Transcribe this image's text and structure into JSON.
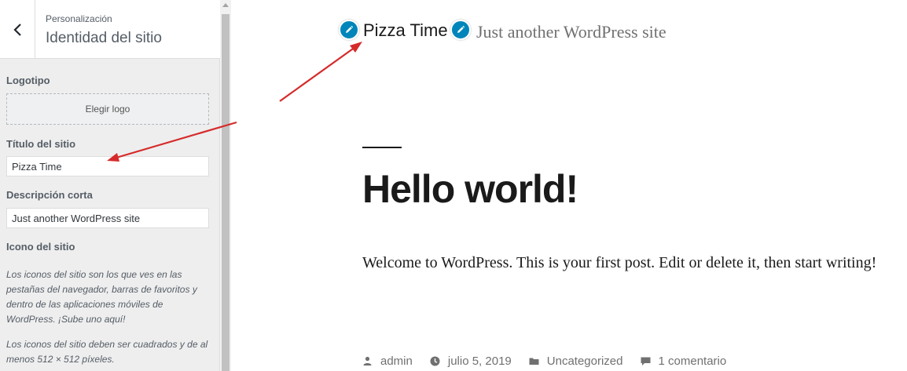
{
  "sidebar": {
    "breadcrumb": "Personalización",
    "title": "Identidad del sitio",
    "logo": {
      "label": "Logotipo",
      "button": "Elegir logo"
    },
    "site_title": {
      "label": "Título del sitio",
      "value": "Pizza Time"
    },
    "tagline": {
      "label": "Descripción corta",
      "value": "Just another WordPress site"
    },
    "site_icon": {
      "label": "Icono del sitio",
      "help1": "Los iconos del sitio son los que ves en las pestañas del navegador, barras de favoritos y dentro de las aplicaciones móviles de WordPress. ¡Sube uno aquí!",
      "help2": "Los iconos del sitio deben ser cuadrados y de al menos 512 × 512 píxeles."
    }
  },
  "preview": {
    "site_title": "Pizza Time",
    "site_description": "Just another WordPress site",
    "post": {
      "title": "Hello world!",
      "body": "Welcome to WordPress. This is your first post. Edit or delete it, then start writing!",
      "meta": {
        "author": "admin",
        "date": "julio 5, 2019",
        "category": "Uncategorized",
        "comments": "1 comentario"
      }
    }
  },
  "colors": {
    "accent": "#0085ba",
    "annotation_arrow": "#d62a2a"
  },
  "icons": [
    "back-chevron-icon",
    "pencil-icon",
    "user-icon",
    "clock-icon",
    "folder-icon",
    "comment-icon"
  ]
}
